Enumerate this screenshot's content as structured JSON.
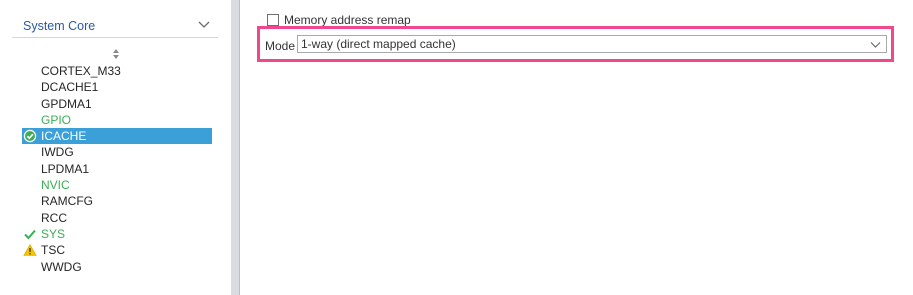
{
  "sidebar": {
    "category_title": "System Core",
    "items": [
      {
        "label": "CORTEX_M33",
        "status": "none"
      },
      {
        "label": "DCACHE1",
        "status": "none"
      },
      {
        "label": "GPDMA1",
        "status": "none"
      },
      {
        "label": "GPIO",
        "status": "configured"
      },
      {
        "label": "ICACHE",
        "status": "enabled-selected"
      },
      {
        "label": "IWDG",
        "status": "none"
      },
      {
        "label": "LPDMA1",
        "status": "none"
      },
      {
        "label": "NVIC",
        "status": "configured"
      },
      {
        "label": "RAMCFG",
        "status": "none"
      },
      {
        "label": "RCC",
        "status": "none"
      },
      {
        "label": "SYS",
        "status": "enabled"
      },
      {
        "label": "TSC",
        "status": "warning"
      },
      {
        "label": "WWDG",
        "status": "none"
      }
    ]
  },
  "config": {
    "memory_remap_label": "Memory address remap",
    "memory_remap_checked": false,
    "mode_label": "Mode",
    "mode_value": "1-way (direct mapped cache)"
  },
  "colors": {
    "selected_bg": "#3b9fd8",
    "configured_text": "#3cae55",
    "warning": "#f2c500",
    "highlight_border": "#f0488f"
  }
}
